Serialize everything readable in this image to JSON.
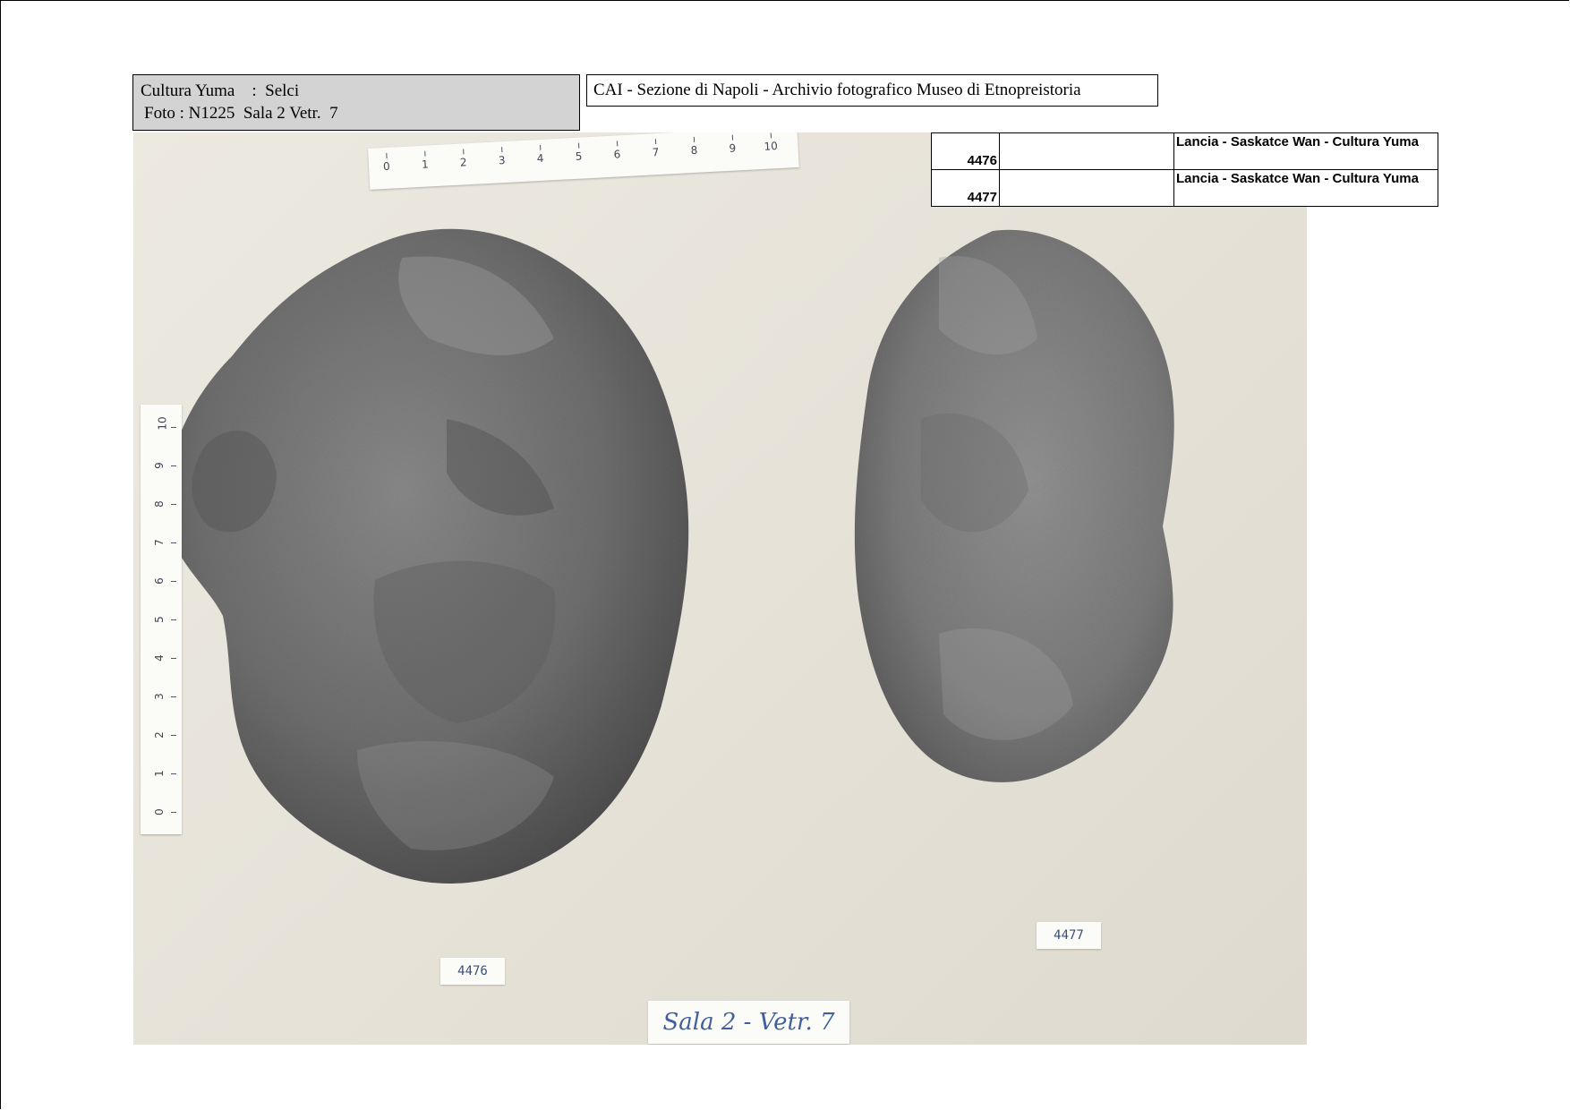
{
  "header": {
    "left_line1": "Cultura Yuma    :  Selci",
    "left_line2": "Foto : N1225  Sala 2 Vetr.  7",
    "right_title": "CAI - Sezione di Napoli  - Archivio fotografico Museo di Etnopreistoria"
  },
  "catalog": {
    "rows": [
      {
        "id": "4476",
        "col2": "",
        "description": "Lancia - Saskatce Wan - Cultura Yuma"
      },
      {
        "id": "4477",
        "col2": "",
        "description": "Lancia - Saskatce Wan - Cultura Yuma"
      }
    ]
  },
  "photo": {
    "ruler_horizontal_ticks": [
      "0",
      "1",
      "2",
      "3",
      "4",
      "5",
      "6",
      "7",
      "8",
      "9",
      "10"
    ],
    "ruler_vertical_ticks": [
      "0",
      "1",
      "2",
      "3",
      "4",
      "5",
      "6",
      "7",
      "8",
      "9",
      "10"
    ],
    "tag_4476": "4476",
    "tag_4477": "4477",
    "tag_sala": "Sala 2 - Vetr. 7"
  }
}
